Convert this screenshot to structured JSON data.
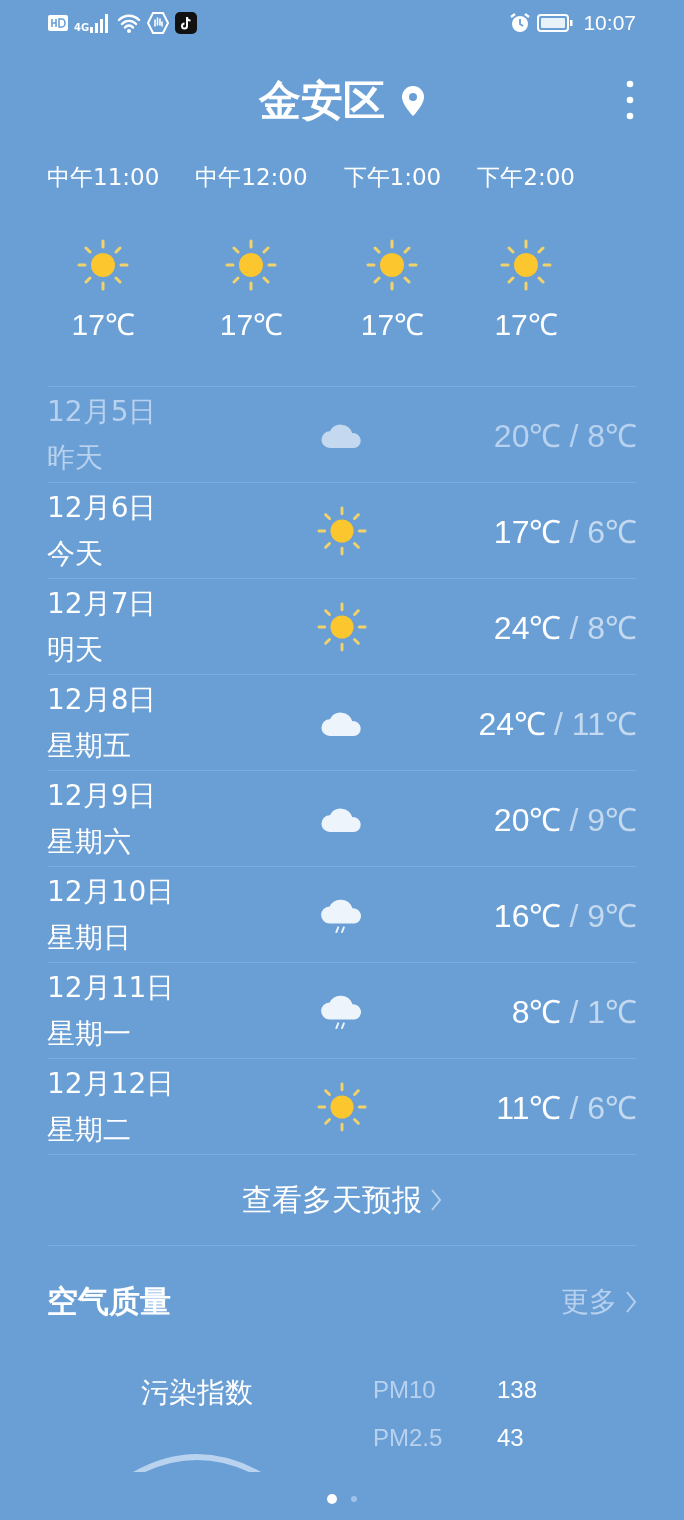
{
  "status_bar": {
    "network": "4G",
    "time": "10:07"
  },
  "header": {
    "city": "金安区"
  },
  "hourly": [
    {
      "time": "中午11:00",
      "kind": "sunny",
      "temp": "17℃"
    },
    {
      "time": "中午12:00",
      "kind": "sunny",
      "temp": "17℃"
    },
    {
      "time": "下午1:00",
      "kind": "sunny",
      "temp": "17℃"
    },
    {
      "time": "下午2:00",
      "kind": "sunny",
      "temp": "17℃"
    }
  ],
  "daily": [
    {
      "date": "12月5日",
      "day": "昨天",
      "kind": "cloudy",
      "high": "20℃",
      "low": "/ 8℃",
      "past": true
    },
    {
      "date": "12月6日",
      "day": "今天",
      "kind": "sunny",
      "high": "17℃",
      "low": "/ 6℃",
      "past": false
    },
    {
      "date": "12月7日",
      "day": "明天",
      "kind": "sunny",
      "high": "24℃",
      "low": "/ 8℃",
      "past": false
    },
    {
      "date": "12月8日",
      "day": "星期五",
      "kind": "cloudy",
      "high": "24℃",
      "low": "/ 11℃",
      "past": false
    },
    {
      "date": "12月9日",
      "day": "星期六",
      "kind": "cloudy",
      "high": "20℃",
      "low": "/ 9℃",
      "past": false
    },
    {
      "date": "12月10日",
      "day": "星期日",
      "kind": "rain",
      "high": "16℃",
      "low": "/ 9℃",
      "past": false
    },
    {
      "date": "12月11日",
      "day": "星期一",
      "kind": "rain",
      "high": "8℃",
      "low": "/ 1℃",
      "past": false
    },
    {
      "date": "12月12日",
      "day": "星期二",
      "kind": "sunny",
      "high": "11℃",
      "low": "/ 6℃",
      "past": false
    }
  ],
  "more_forecast": "查看多天预报",
  "air_quality": {
    "title": "空气质量",
    "more": "更多",
    "index_label": "污染指数",
    "pollutants": [
      {
        "name": "PM10",
        "value": "138"
      },
      {
        "name": "PM2.5",
        "value": "43"
      }
    ]
  },
  "pager": [
    {
      "selected": true
    },
    {
      "selected": false
    }
  ]
}
